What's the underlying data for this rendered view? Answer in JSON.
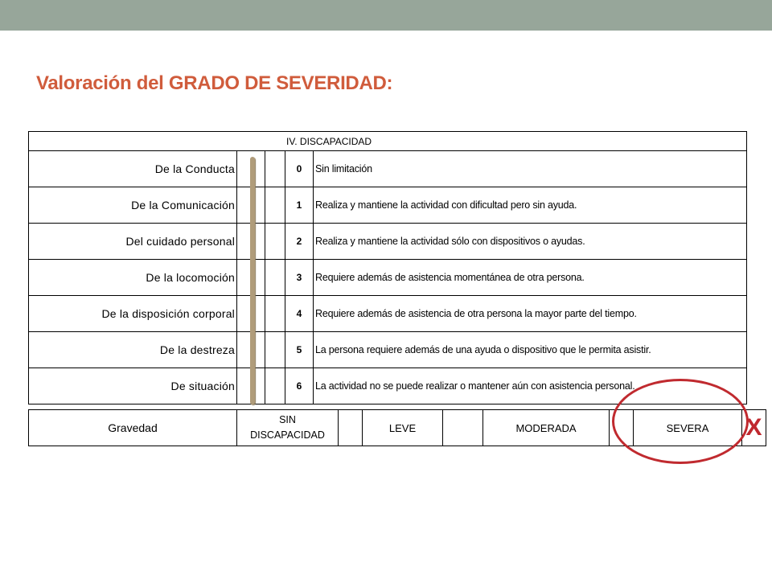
{
  "title": "Valoración del GRADO DE SEVERIDAD:",
  "table": {
    "header": "IV.   DISCAPACIDAD",
    "rows": [
      {
        "label": "De la Conducta",
        "num": "0",
        "desc": "Sin limitación"
      },
      {
        "label": "De la Comunicación",
        "num": "1",
        "desc": "Realiza y mantiene la actividad con dificultad pero sin ayuda."
      },
      {
        "label": "Del cuidado personal",
        "num": "2",
        "desc": "Realiza y mantiene la actividad sólo con dispositivos o ayudas."
      },
      {
        "label": "De la locomoción",
        "num": "3",
        "desc": "Requiere además de asistencia momentánea de otra persona."
      },
      {
        "label": "De la disposición corporal",
        "num": "4",
        "desc": "Requiere además de asistencia de otra persona la mayor parte del tiempo."
      },
      {
        "label": "De la destreza",
        "num": "5",
        "desc": "La persona requiere además de una ayuda o dispositivo que le permita asistir."
      },
      {
        "label": "De situación",
        "num": "6",
        "desc": "La actividad no se puede realizar o mantener aún con asistencia personal."
      }
    ]
  },
  "gravedad": {
    "label": "Gravedad",
    "sin_1": "SIN",
    "sin_2": "DISCAPACIDAD",
    "leve": "LEVE",
    "moderada": "MODERADA",
    "severa": "SEVERA",
    "mark": "X"
  },
  "colors": {
    "title": "#d05c3c",
    "topbar": "#97a69a",
    "annotation": "#c02a2f",
    "bar": "#b09c7a"
  }
}
